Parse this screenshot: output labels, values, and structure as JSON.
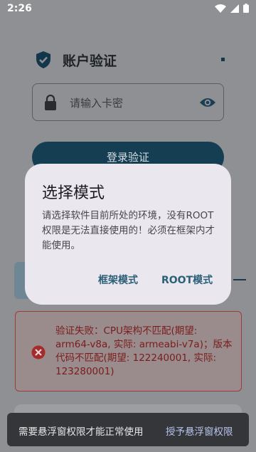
{
  "status_bar": {
    "time": "2:26"
  },
  "header": {
    "title": "账户验证"
  },
  "password": {
    "placeholder": "请输入卡密"
  },
  "login_button": {
    "label": "登录验证"
  },
  "error": {
    "message": "验证失败：CPU架构不匹配(期望: arm64-v8a, 实际: armeabi-v7a)；版本代码不匹配(期望: 122240001, 实际: 123280001)"
  },
  "dialog": {
    "title": "选择模式",
    "body": "请选择软件目前所处的环境，没有ROOT权限是无法直接使用的！必须在框架内才能使用。",
    "buttons": {
      "frame": "框架模式",
      "root": "ROOT模式"
    }
  },
  "snackbar": {
    "message": "需要悬浮窗权限才能正常使用",
    "action": "授予悬浮窗权限"
  },
  "colors": {
    "primary": "#163e52",
    "error": "#a13a3a",
    "dialog_bg": "#ebe7ef",
    "dialog_action": "#2c5f78"
  }
}
